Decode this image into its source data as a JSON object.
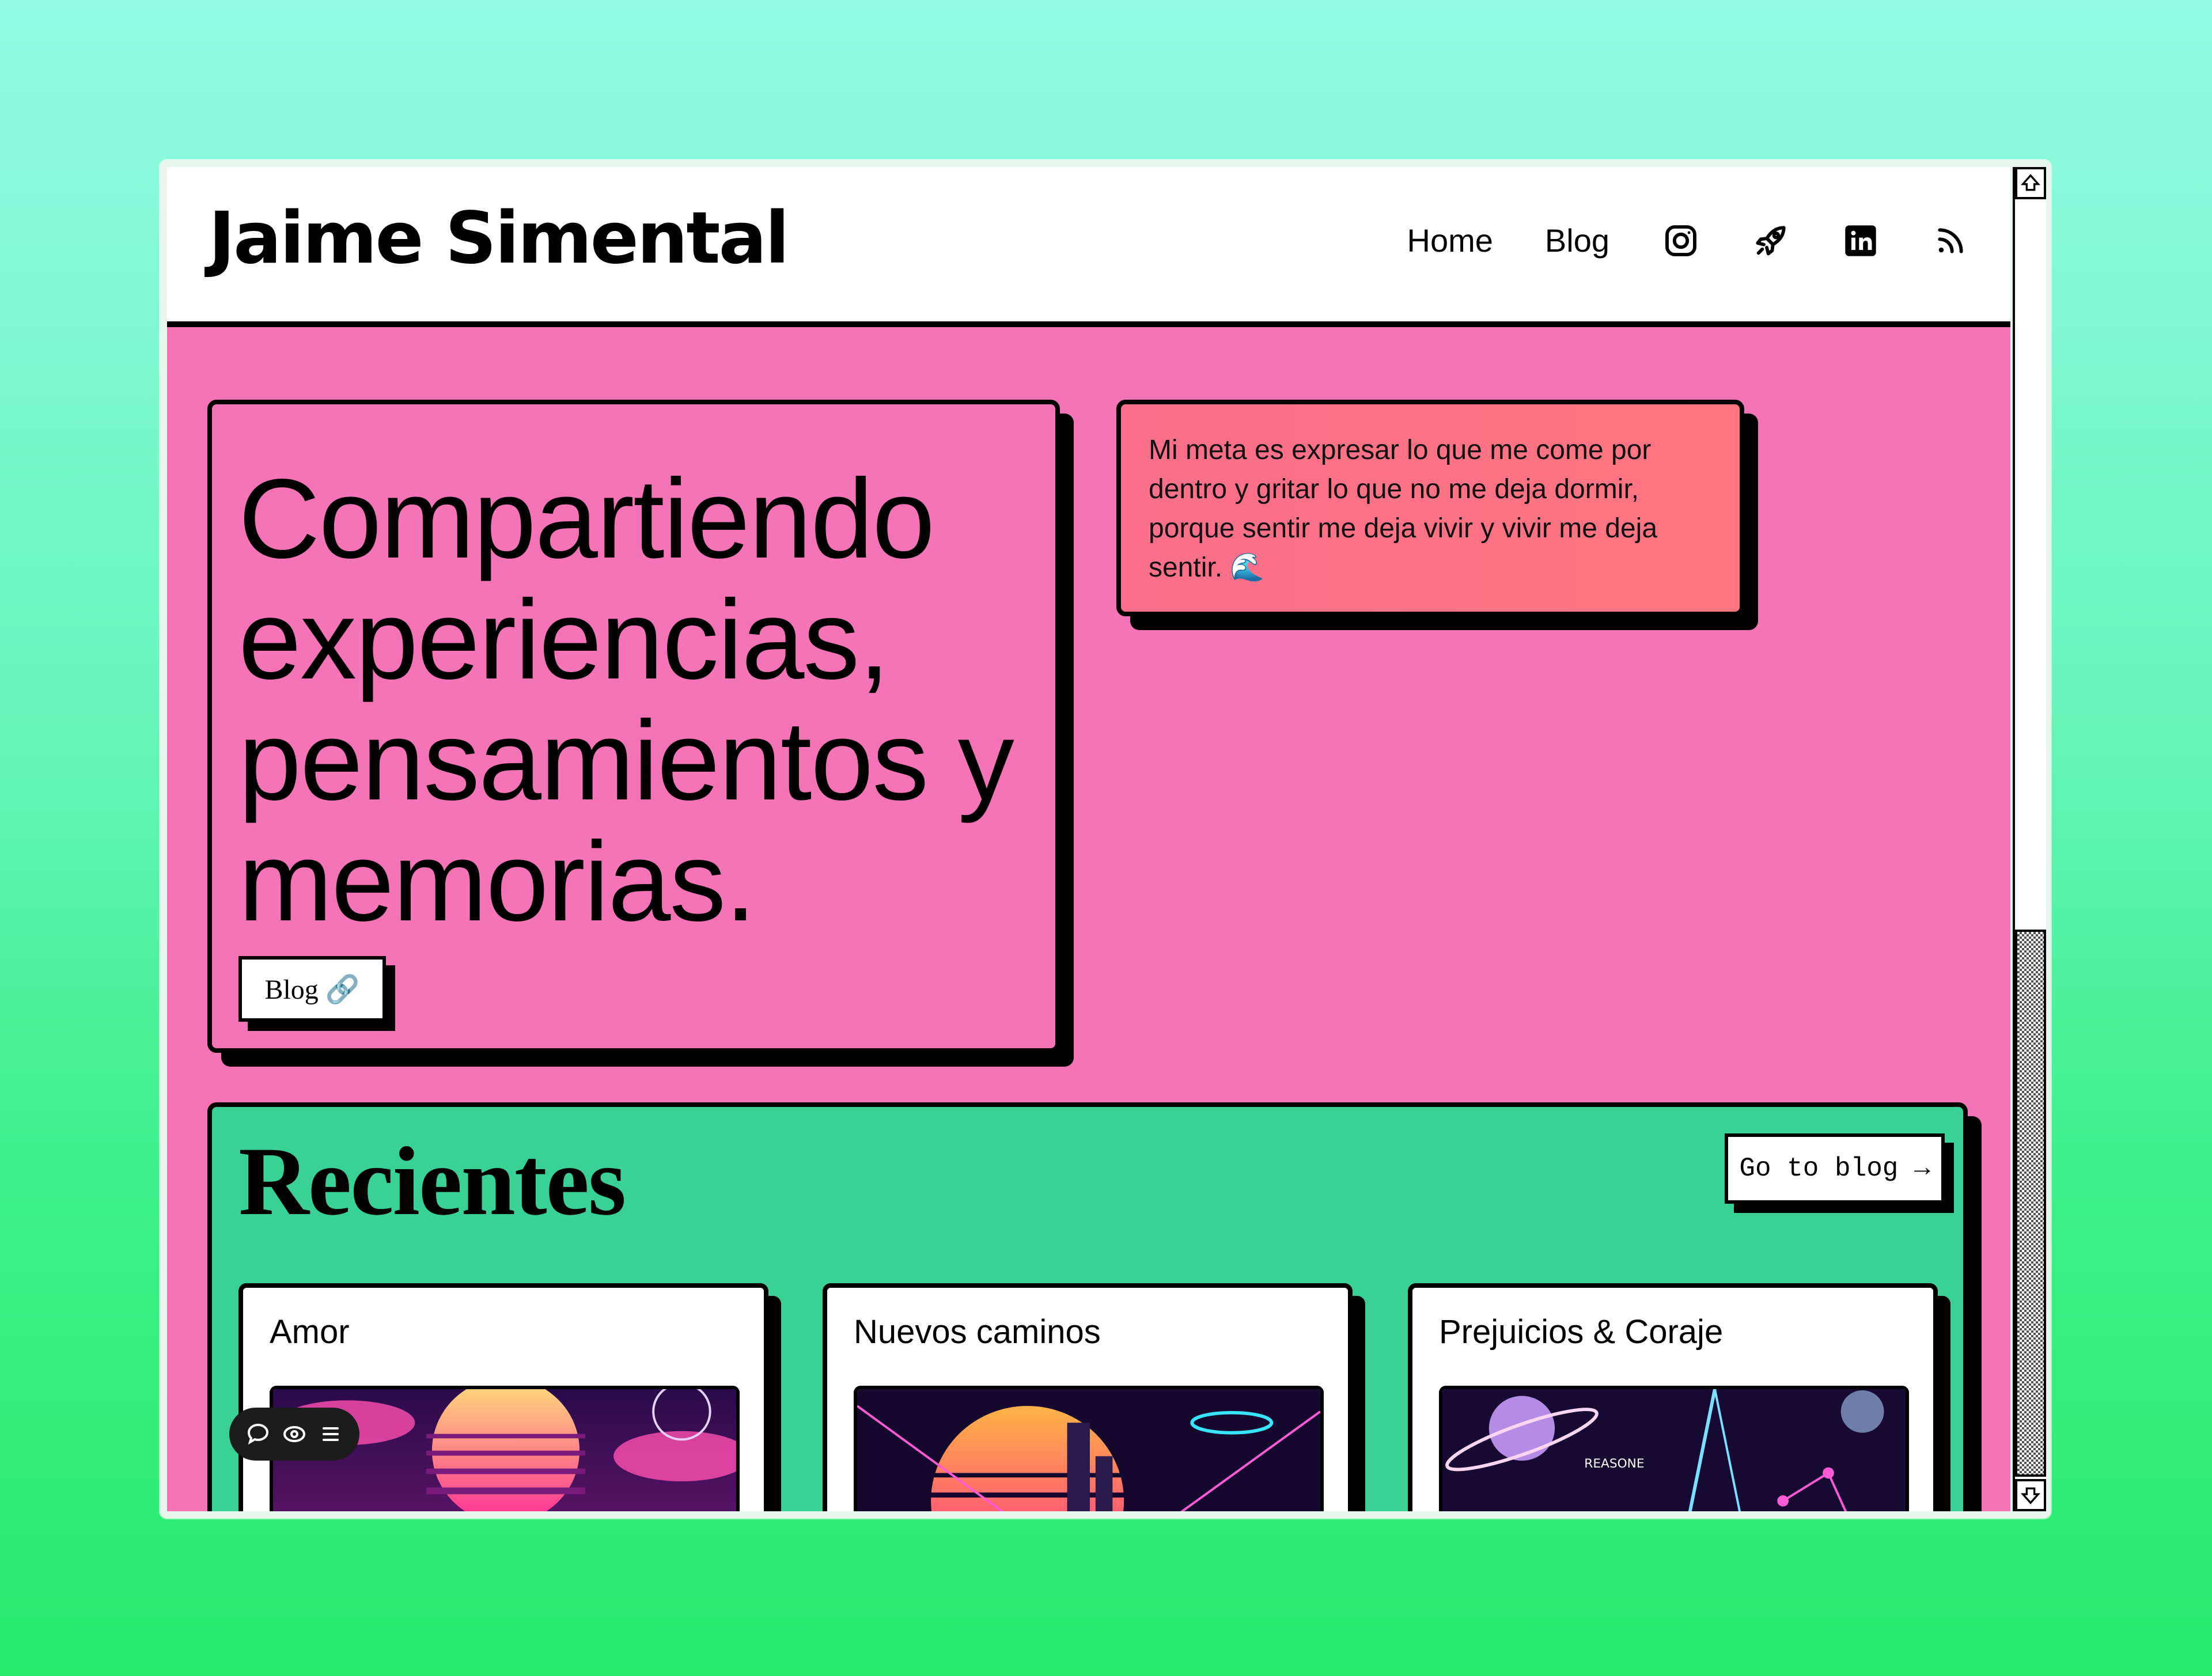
{
  "header": {
    "logo": "Jaime Simental",
    "nav": {
      "home": "Home",
      "blog": "Blog"
    },
    "icons": [
      "instagram-icon",
      "rocket-icon",
      "linkedin-icon",
      "rss-icon"
    ]
  },
  "hero": {
    "title": "Compartiendo experiencias, pensamientos y memorias.",
    "button_label": "Blog 🔗"
  },
  "quote": {
    "text": "Mi meta es expresar lo que me come por dentro y gritar lo que no me deja dormir, porque sentir me deja vivir y vivir me deja sentir. 🌊"
  },
  "recents": {
    "title": "Recientes",
    "go_label": "Go to blog →",
    "posts": [
      {
        "title": "Amor"
      },
      {
        "title": "Nuevos caminos"
      },
      {
        "title": "Prejuicios & Coraje",
        "image_text": "REASONE"
      }
    ]
  },
  "colors": {
    "page_pink": "#f474b7",
    "quote_coral": "#ff7580",
    "recents_green": "#39d196",
    "ink": "#000000"
  }
}
